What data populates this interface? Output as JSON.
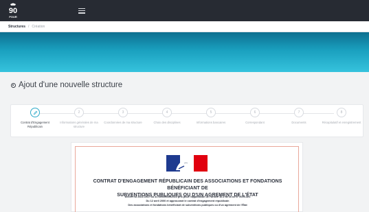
{
  "topbar": {
    "logo_text": "90",
    "logo_caption": "POUR",
    "menu_icon": "hamburger-icon"
  },
  "breadcrumb": {
    "items": [
      "Structures",
      "Création"
    ],
    "separator": "/"
  },
  "banner": {
    "colors": [
      "#0d6f90",
      "#1aa0bf",
      "#36c3dd"
    ]
  },
  "page": {
    "title": "Ajout d'une nouvelle structure",
    "title_icon": "radio-circle-icon"
  },
  "stepper": {
    "accent_color": "#2ba9c8",
    "steps": [
      {
        "number": "1",
        "label": "Contrat d'Engagement Républicain",
        "active": true
      },
      {
        "number": "2",
        "label": "Informations générales de ma structure",
        "active": false
      },
      {
        "number": "3",
        "label": "Coordonnées de ma structure",
        "active": false
      },
      {
        "number": "4",
        "label": "Choix des disciplines",
        "active": false
      },
      {
        "number": "5",
        "label": "Informations bancaires",
        "active": false
      },
      {
        "number": "6",
        "label": "Correspondant",
        "active": false
      },
      {
        "number": "7",
        "label": "Documents",
        "active": false
      },
      {
        "number": "8",
        "label": "Récapitulatif et enregistrement",
        "active": false
      }
    ]
  },
  "document": {
    "logo": "marianne-flag-logo",
    "title_line1": "CONTRAT D'ENGAGEMENT RÉPUBLICAIN DES ASSOCIATIONS ET FONDATIONS BÉNÉFICIANT DE",
    "title_line2": "SUBVENTIONS PUBLIQUES OU D'UN AGREMENT DE L'ÉTAT",
    "lines": [
      "Décret no 2021-1947 du 31 décembre 2021 pris pour l'application de l'article 10-1 de la loi N° 2000-321",
      "Du 12 avril 2000 et approuvant le contrat d'engagement républicain",
      "Des associations et fondations bénéficiant de subventions publiques ou d'un agrément de l'État"
    ]
  }
}
